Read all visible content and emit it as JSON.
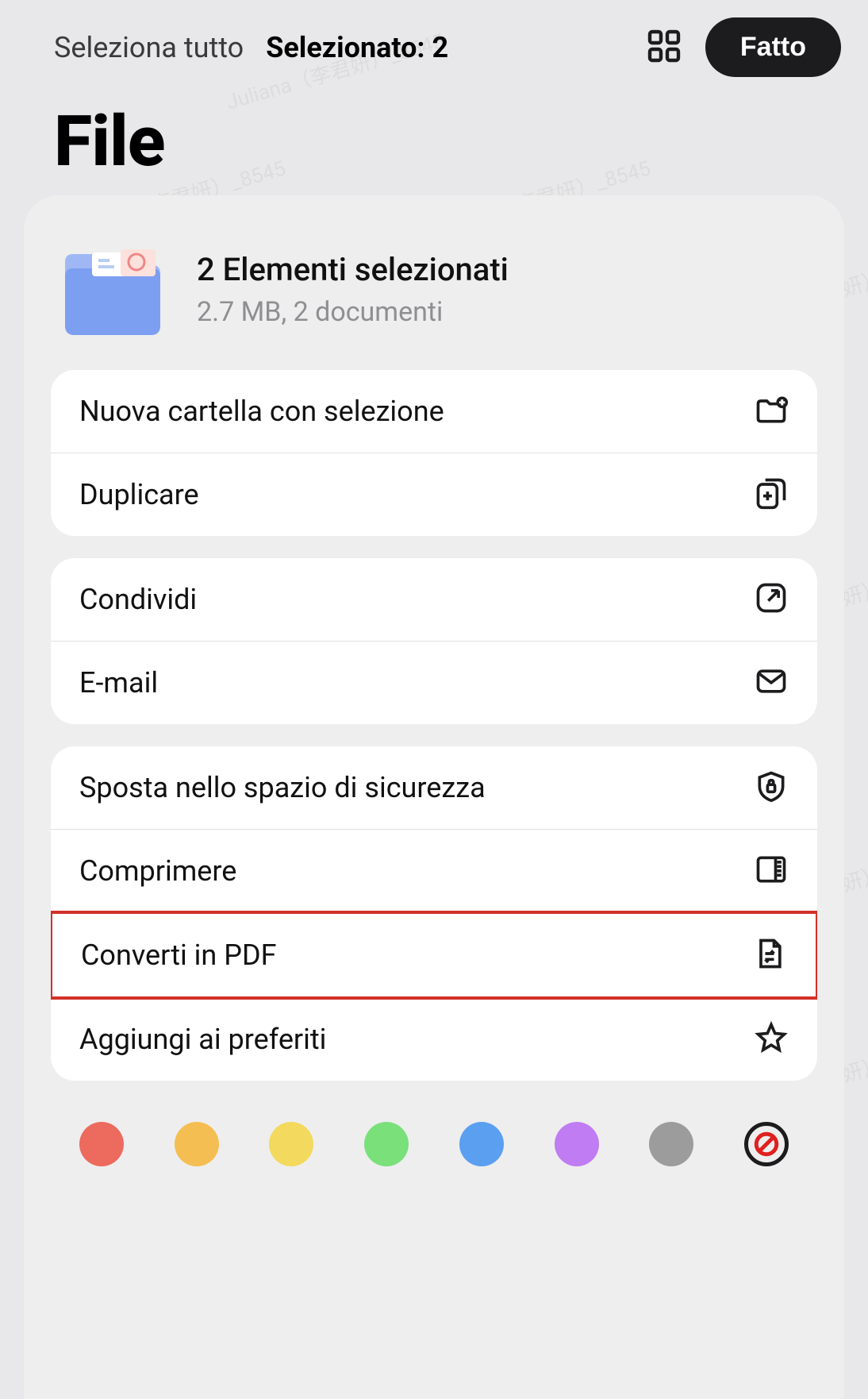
{
  "topbar": {
    "select_all": "Seleziona tutto",
    "selected": "Selezionato: 2",
    "done": "Fatto"
  },
  "page_title": "File",
  "summary": {
    "title": "2 Elementi selezionati",
    "meta": "2.7 MB, 2 documenti"
  },
  "groups": [
    {
      "rows": [
        {
          "label": "Nuova cartella con selezione",
          "icon": "folder-plus-icon"
        },
        {
          "label": "Duplicare",
          "icon": "duplicate-icon"
        }
      ]
    },
    {
      "rows": [
        {
          "label": "Condividi",
          "icon": "share-icon"
        },
        {
          "label": "E-mail",
          "icon": "mail-icon"
        }
      ]
    },
    {
      "rows": [
        {
          "label": "Sposta nello spazio di sicurezza",
          "icon": "shield-lock-icon"
        },
        {
          "label": "Comprimere",
          "icon": "archive-icon"
        },
        {
          "label": "Converti in PDF",
          "icon": "convert-icon",
          "highlighted": true
        },
        {
          "label": "Aggiungi ai preferiti",
          "icon": "star-icon"
        }
      ]
    }
  ],
  "tags": {
    "colors": [
      "#ed6a5e",
      "#f5be52",
      "#f3d95d",
      "#79e07a",
      "#5a9ff0",
      "#c07cf2",
      "#9c9c9c"
    ]
  },
  "watermark": "Juliana（李君妍）_8545"
}
